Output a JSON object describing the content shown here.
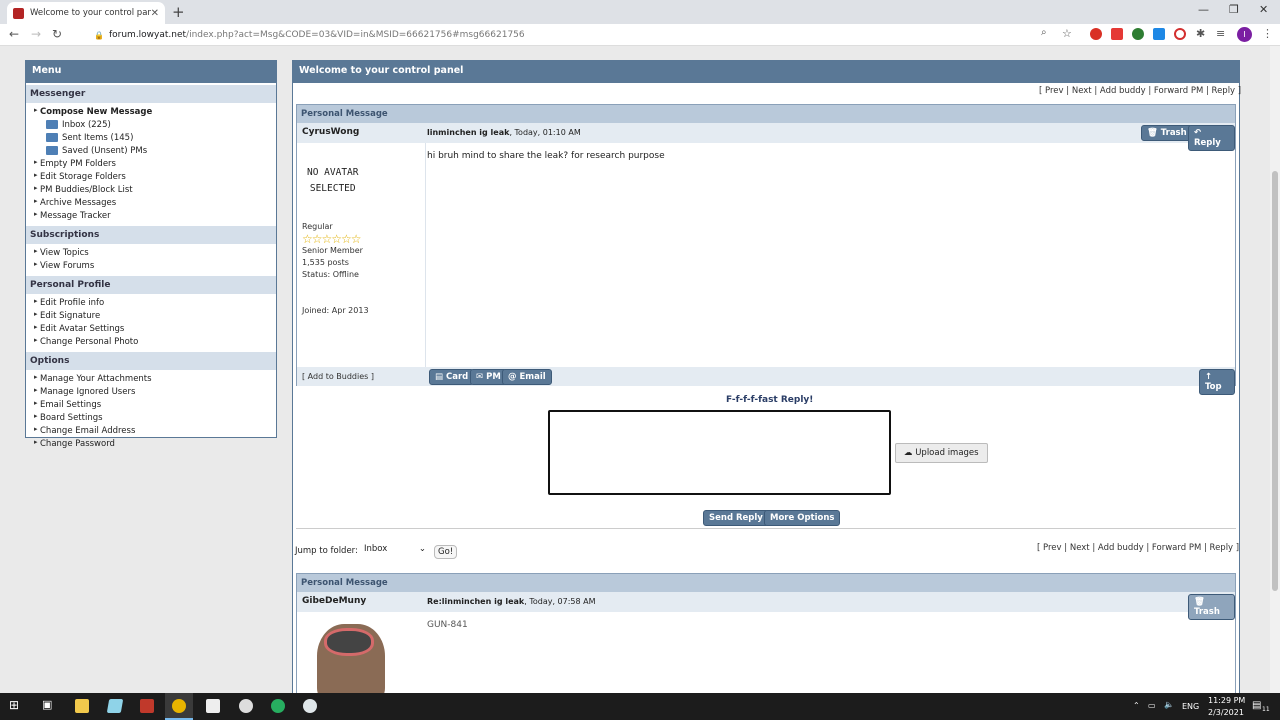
{
  "browser": {
    "tab_title": "Welcome to your control panel",
    "url_host": "forum.lowyat.net",
    "url_path": "/index.php?act=Msg&CODE=03&VID=in&MSID=66621756#msg66621756",
    "avatar_letter": "I"
  },
  "menu": {
    "title": "Menu",
    "sections": [
      {
        "label": "Messenger"
      },
      {
        "label": "Subscriptions"
      },
      {
        "label": "Personal Profile"
      },
      {
        "label": "Options"
      }
    ],
    "messenger": {
      "compose": "Compose New Message",
      "inbox": "Inbox (225)",
      "sent": "Sent Items (145)",
      "saved": "Saved (Unsent) PMs",
      "items": [
        "Empty PM Folders",
        "Edit Storage Folders",
        "PM Buddies/Block List",
        "Archive Messages",
        "Message Tracker"
      ]
    },
    "subscriptions": [
      "View Topics",
      "View Forums"
    ],
    "profile": [
      "Edit Profile info",
      "Edit Signature",
      "Edit Avatar Settings",
      "Change Personal Photo"
    ],
    "options": [
      "Manage Your Attachments",
      "Manage Ignored Users",
      "Email Settings",
      "Board Settings",
      "Change Email Address",
      "Change Password"
    ]
  },
  "main": {
    "title": "Welcome to your control panel",
    "links": "[ Prev | Next | Add buddy | Forward PM | Reply ]"
  },
  "pm1": {
    "header": "Personal Message",
    "author": "CyrusWong",
    "subject": "linminchen ig leak",
    "time": ", Today, 01:10 AM",
    "trash": "Trash",
    "reply": "Reply",
    "body": "hi bruh mind to share the leak? for research purpose",
    "no_avatar_1": "NO AVATAR",
    "no_avatar_2": "SELECTED",
    "rank": "Regular",
    "stars_shown": 6,
    "group": "Senior Member",
    "posts": "1,535 posts",
    "status": "Status: Offline",
    "joined": "Joined: Apr 2013",
    "add_buddies": "[ Add to Buddies ]",
    "card": "Card",
    "pm": "PM",
    "email": "Email",
    "top": "Top"
  },
  "reply": {
    "label": "F-f-f-f-fast Reply!",
    "upload": "Upload images",
    "send": "Send Reply",
    "more": "More Options"
  },
  "jump": {
    "label": "Jump to folder:",
    "value": "Inbox",
    "go": "Go!"
  },
  "pm2": {
    "header": "Personal Message",
    "author": "GibeDeMuny",
    "subject": "Re:linminchen ig leak",
    "time": ", Today, 07:58 AM",
    "trash": "Trash",
    "body": "GUN-841"
  },
  "taskbar": {
    "lang": "ENG",
    "time": "11:29 PM",
    "date": "2/3/2021",
    "notif": "11"
  }
}
